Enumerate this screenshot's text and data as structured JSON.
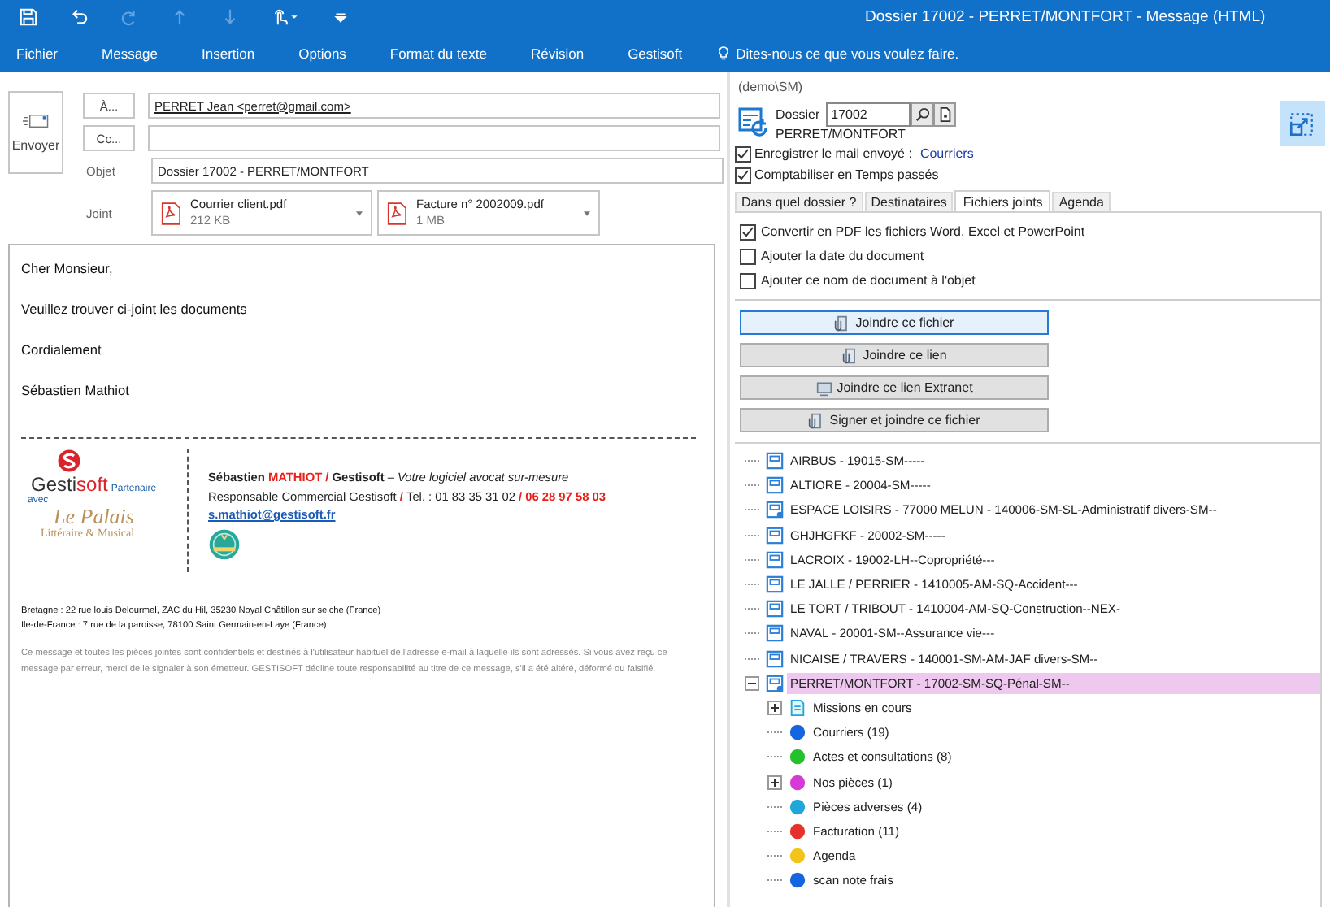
{
  "window": {
    "title": "Dossier 17002 - PERRET/MONTFORT - Message (HTML)"
  },
  "quick_access": [
    {
      "kind": "save",
      "disabled": false
    },
    {
      "kind": "undo",
      "disabled": false
    },
    {
      "kind": "redo",
      "disabled": true
    },
    {
      "kind": "up",
      "disabled": true
    },
    {
      "kind": "down",
      "disabled": true
    },
    {
      "kind": "touch",
      "disabled": false
    },
    {
      "kind": "customize",
      "disabled": false
    }
  ],
  "menu": [
    "Fichier",
    "Message",
    "Insertion",
    "Options",
    "Format du texte",
    "Révision",
    "Gestisoft"
  ],
  "tell_me": "Dites-nous ce que vous voulez faire.",
  "compose": {
    "send_button": "Envoyer",
    "to_button": "À...",
    "to_value": "PERRET Jean <perret@gmail.com>",
    "cc_button": "Cc...",
    "subject_label": "Objet",
    "subject_value": "Dossier 17002 - PERRET/MONTFORT",
    "attach_label": "Joint",
    "attachments": [
      {
        "name": "Courrier client.pdf",
        "size": "212 KB"
      },
      {
        "name": "Facture n° 2002009.pdf",
        "size": "1 MB"
      }
    ]
  },
  "body": {
    "paragraphs": [
      "Cher Monsieur,",
      "Veuillez trouver ci-joint les documents",
      "Cordialement",
      "Sébastien Mathiot"
    ],
    "logo": {
      "name_a": "Gesti",
      "name_b": "soft",
      "partner": "Partenaire",
      "with": "avec",
      "palais": "Le Palais",
      "palais_sub": "Littéraire & Musical"
    },
    "signature": [
      [
        {
          "text": "Sébastien ",
          "kind": "bold"
        },
        {
          "text": "MATHIOT / ",
          "kind": "red"
        },
        {
          "text": "Gestisoft",
          "kind": "bold"
        },
        {
          "text": " – ",
          "kind": "plain"
        },
        {
          "text": "Votre logiciel avocat sur-mesure",
          "kind": "italic"
        }
      ],
      [
        {
          "text": "Responsable Commercial Gestisoft ",
          "kind": "plain"
        },
        {
          "text": "/ ",
          "kind": "red"
        },
        {
          "text": "Tel. : 01 83 35 31 02 ",
          "kind": "plain"
        },
        {
          "text": "/ 06 28 97 58 03",
          "kind": "red"
        }
      ]
    ],
    "email": "s.mathiot@gestisoft.fr",
    "addresses": [
      "Bretagne : 22 rue louis Delourmel, ZAC du Hil, 35230 Noyal Châtillon sur seiche (France)",
      "Ile-de-France : 7 rue de la paroisse, 78100 Saint Germain-en-Laye (France)"
    ],
    "disclaimer": "Ce message et toutes les pièces jointes sont confidentiels et destinés à l'utilisateur habituel de l'adresse e-mail à laquelle ils sont adressés. Si vous avez reçu ce message par erreur, merci de le signaler à son émetteur. GESTISOFT décline toute responsabilité au titre de ce message, s'il a été altéré, déformé ou falsifié."
  },
  "panel": {
    "user": "(demo\\SM)",
    "dossier_label": "Dossier",
    "dossier_value": "17002",
    "dossier_name": "PERRET/MONTFORT",
    "options": [
      {
        "label": "Enregistrer le mail envoyé :",
        "link": "Courriers",
        "checked": true
      },
      {
        "label": "Comptabiliser en Temps passés",
        "checked": true
      }
    ],
    "tabs": [
      {
        "label": "Dans quel dossier ?",
        "selected": false
      },
      {
        "label": "Destinataires",
        "selected": false
      },
      {
        "label": "Fichiers joints",
        "selected": true
      },
      {
        "label": "Agenda",
        "selected": false
      }
    ],
    "attach_options": [
      {
        "label": "Convertir en PDF les fichiers Word, Excel et PowerPoint",
        "checked": true
      },
      {
        "label": "Ajouter la date du document",
        "checked": false
      },
      {
        "label": "Ajouter ce nom de document à l'objet",
        "checked": false
      }
    ],
    "buttons": [
      {
        "label": "Joindre ce fichier",
        "kind": "file",
        "focused": true
      },
      {
        "label": "Joindre ce lien",
        "kind": "file",
        "focused": false
      },
      {
        "label": "Joindre ce lien Extranet",
        "kind": "web",
        "focused": false
      },
      {
        "label": "Signer et joindre ce fichier",
        "kind": "file",
        "focused": false
      }
    ]
  },
  "tree": [
    {
      "label": "AIRBUS - 19015-SM-----",
      "kind": "folder",
      "selected": false
    },
    {
      "label": "ALTIORE - 20004-SM-----",
      "kind": "folder",
      "selected": false
    },
    {
      "label": "ESPACE LOISIRS  - 77000 MELUN - 140006-SM-SL-Administratif divers-SM--",
      "kind": "shared",
      "selected": false
    },
    {
      "label": "GHJHGFKF - 20002-SM-----",
      "kind": "folder",
      "selected": false
    },
    {
      "label": "LACROIX - 19002-LH--Copropriété---",
      "kind": "folder",
      "selected": false
    },
    {
      "label": "LE JALLE / PERRIER - 1410005-AM-SQ-Accident---",
      "kind": "folder",
      "selected": false
    },
    {
      "label": "LE TORT / TRIBOUT - 1410004-AM-SQ-Construction--NEX-",
      "kind": "folder",
      "selected": false
    },
    {
      "label": "NAVAL - 20001-SM--Assurance vie---",
      "kind": "folder",
      "selected": false
    },
    {
      "label": "NICAISE / TRAVERS - 140001-SM-AM-JAF divers-SM--",
      "kind": "folder",
      "selected": false
    },
    {
      "label": "PERRET/MONTFORT - 17002-SM-SQ-Pénal-SM--",
      "kind": "shared",
      "selected": true,
      "expanded": true,
      "children": [
        {
          "label": "Missions en cours",
          "kind": "document",
          "selected": false,
          "expanded": false
        },
        {
          "label": "Courriers (19)",
          "kind": "category",
          "color": "#1565e0",
          "selected": false
        },
        {
          "label": "Actes et consultations (8)",
          "kind": "category",
          "color": "#22c32a",
          "selected": false
        },
        {
          "label": "Nos pièces (1)",
          "kind": "category",
          "color": "#d63ad6",
          "selected": false,
          "expanded": false
        },
        {
          "label": "Pièces adverses (4)",
          "kind": "category",
          "color": "#1ea7d8",
          "selected": false
        },
        {
          "label": "Facturation (11)",
          "kind": "category",
          "color": "#e8302a",
          "selected": false
        },
        {
          "label": "Agenda",
          "kind": "category",
          "color": "#f2c41a",
          "selected": false
        },
        {
          "label": "scan note frais",
          "kind": "category",
          "color": "#1565e0",
          "selected": false
        }
      ]
    }
  ]
}
